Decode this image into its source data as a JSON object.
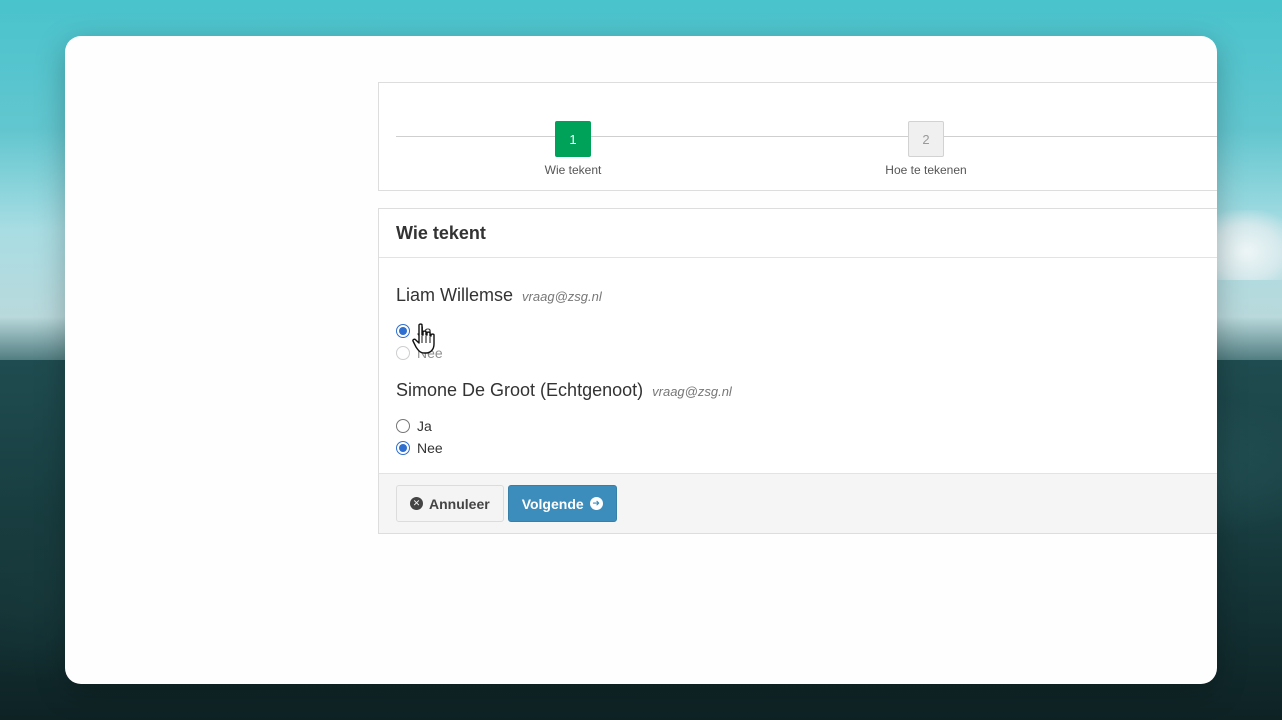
{
  "steps": [
    {
      "number": "1",
      "label": "Wie tekent",
      "state": "active"
    },
    {
      "number": "2",
      "label": "Hoe te tekenen",
      "state": "inactive"
    }
  ],
  "panel": {
    "title": "Wie tekent",
    "signers": [
      {
        "name": "Liam Willemse",
        "email": "vraag@zsg.nl",
        "options": [
          {
            "label": "Ja",
            "checked": true
          },
          {
            "label": "Nee",
            "checked": false
          }
        ]
      },
      {
        "name": "Simone De Groot (Echtgenoot)",
        "email": "vraag@zsg.nl",
        "options": [
          {
            "label": "Ja",
            "checked": false
          },
          {
            "label": "Nee",
            "checked": true
          }
        ]
      }
    ]
  },
  "footer": {
    "cancel_label": "Annuleer",
    "next_label": "Volgende"
  },
  "colors": {
    "step_active": "#00a25a",
    "primary_button": "#3c8dbc",
    "radio_checked": "#2f6fcf"
  },
  "icons": {
    "cancel": "times-circle-icon",
    "next": "arrow-circle-right-icon",
    "cursor": "hand-pointer-cursor"
  }
}
